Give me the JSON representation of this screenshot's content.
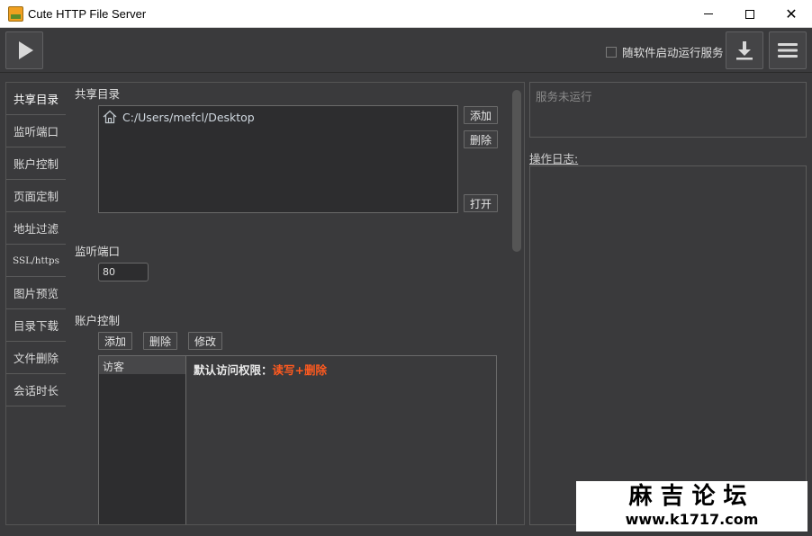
{
  "window": {
    "title": "Cute HTTP File Server"
  },
  "toolbar": {
    "autostart_label": "随软件启动运行服务",
    "autostart_checked": false
  },
  "nav": {
    "items": [
      {
        "label": "共享目录",
        "active": true
      },
      {
        "label": "监听端口"
      },
      {
        "label": "账户控制"
      },
      {
        "label": "页面定制"
      },
      {
        "label": "地址过滤"
      },
      {
        "label": "SSL/https"
      },
      {
        "label": "图片预览"
      },
      {
        "label": "目录下载"
      },
      {
        "label": "文件删除"
      },
      {
        "label": "会话时长"
      }
    ]
  },
  "share": {
    "title": "共享目录",
    "paths": [
      "C:/Users/mefcl/Desktop"
    ],
    "add_label": "添加",
    "delete_label": "删除",
    "open_label": "打开"
  },
  "port": {
    "title": "监听端口",
    "value": "80"
  },
  "account": {
    "title": "账户控制",
    "add_label": "添加",
    "delete_label": "删除",
    "edit_label": "修改",
    "users": [
      "访客"
    ],
    "default_perm_label": "默认访问权限：",
    "default_perm_value": "读写+删除"
  },
  "status": {
    "text": "服务未运行"
  },
  "log": {
    "label": "操作日志:"
  },
  "watermark": {
    "line1": "麻吉论坛",
    "line2": "www.k1717.com"
  }
}
